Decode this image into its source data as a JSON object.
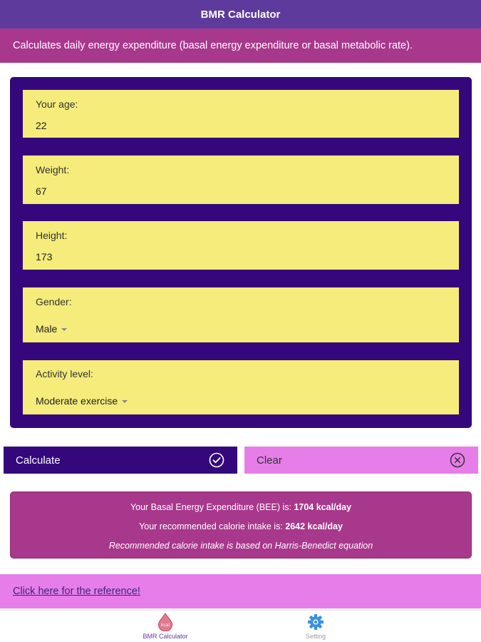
{
  "app": {
    "title": "BMR Calculator"
  },
  "header": {
    "description": "Calculates daily energy expenditure (basal energy expenditure or basal metabolic rate)."
  },
  "form": {
    "age": {
      "label": "Your age:",
      "value": "22"
    },
    "weight": {
      "label": "Weight:",
      "value": "67"
    },
    "height": {
      "label": "Height:",
      "value": "173"
    },
    "gender": {
      "label": "Gender:",
      "selected": "Male"
    },
    "activity": {
      "label": "Activity level:",
      "selected": "Moderate exercise"
    }
  },
  "buttons": {
    "calculate": {
      "label": "Calculate",
      "icon": "check-circle-icon"
    },
    "clear": {
      "label": "Clear",
      "icon": "close-circle-icon"
    }
  },
  "result": {
    "bee_prefix": "Your Basal Energy Expenditure (BEE) is: ",
    "bee_value": "1704 kcal/day",
    "intake_prefix": "Your recommended calorie intake is: ",
    "intake_value": "2642 kcal/day",
    "note": "Recommended calorie intake is based on Harris-Benedict equation"
  },
  "reference": {
    "link_text": "Click here for the reference!"
  },
  "tabs": [
    {
      "label": "BMR Calculator",
      "icon": "kcal-drop-icon",
      "badge": "kcal",
      "active": true
    },
    {
      "label": "Setting",
      "icon": "gear-icon",
      "active": false
    }
  ],
  "colors": {
    "titlebar": "#5e3a9d",
    "header": "#a8388c",
    "form_card": "#34087c",
    "field_bg": "#f6ec7b",
    "clear_button": "#e77de8",
    "reference_bar": "#e77de8"
  }
}
